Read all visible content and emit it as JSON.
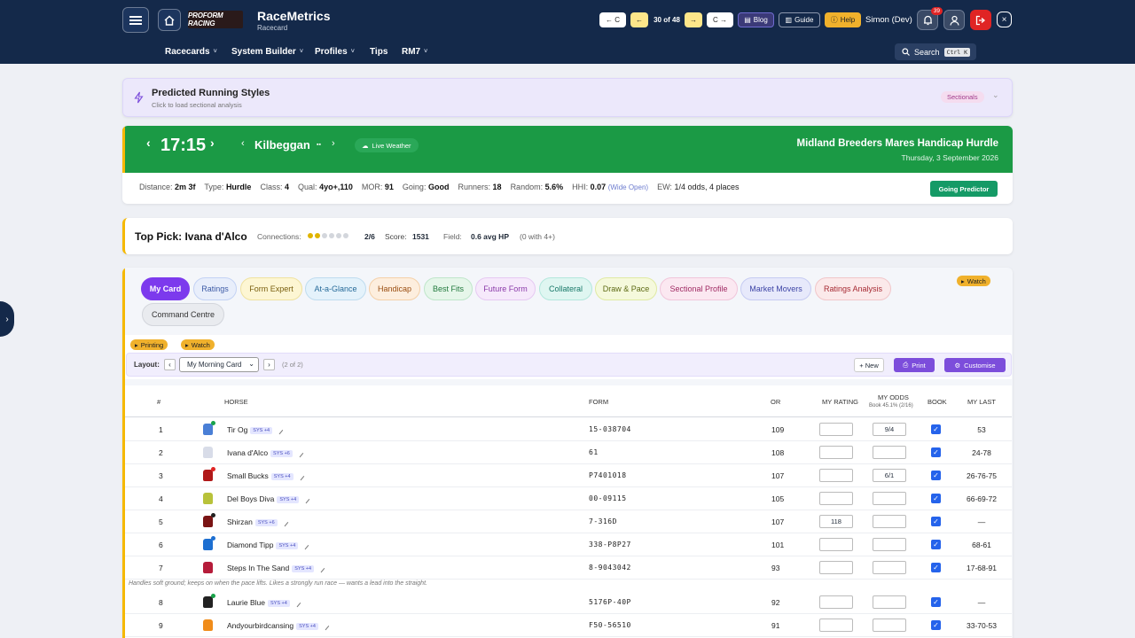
{
  "header": {
    "brand_logo": "PROFORM RACING",
    "app_name": "RaceMetrics",
    "app_sub": "Racecard",
    "prev_c": "← C",
    "nav_count": "30 of 48",
    "next_c": "C →",
    "blog": "Blog",
    "guide": "Guide",
    "help": "Help",
    "user": "Simon (Dev)",
    "notif_count": "39",
    "close": "×"
  },
  "nav": {
    "items": [
      {
        "label": "Racecards",
        "caret": "˅"
      },
      {
        "label": "System Builder",
        "caret": "˅"
      },
      {
        "label": "Profiles",
        "caret": "˅"
      },
      {
        "label": "Tips",
        "caret": ""
      },
      {
        "label": "RM7",
        "caret": "˅"
      }
    ],
    "search_label": "Search",
    "search_kbd": "Ctrl K"
  },
  "predicted": {
    "title": "Predicted Running Styles",
    "subtitle": "Click to load sectional analysis",
    "badge": "Sectionals"
  },
  "race": {
    "time": "17:15",
    "course": "Kilbeggan",
    "weather": "Live Weather",
    "title": "Midland Breeders Mares Handicap Hurdle",
    "date": "Thursday, 3 September 2026",
    "facts": {
      "distance_label": "Distance:",
      "distance": "2m 3f",
      "type_label": "Type:",
      "type": "Hurdle",
      "class_label": "Class:",
      "class": "4",
      "qual_label": "Qual:",
      "qual": "4yo+,110",
      "mor_label": "MOR:",
      "mor": "91",
      "going_label": "Going:",
      "going": "Good",
      "runners_label": "Runners:",
      "runners": "18",
      "random_label": "Random:",
      "random": "5.6%",
      "hhi_label": "HHI:",
      "hhi": "0.07",
      "hhi_note": "(Wide Open)",
      "ew_label": "EW:",
      "ew": "1/4 odds, 4 places"
    },
    "going_predictor": "Going Predictor"
  },
  "top_pick": {
    "title": "Top Pick: Ivana d'Alco",
    "connections_label": "Connections:",
    "connections_value": "2/6",
    "score_label": "Score:",
    "score": "1531",
    "field_label": "Field:",
    "field": "0.6 avg HP",
    "field_note": "(0 with 4+)"
  },
  "tabs": [
    {
      "label": "My Card"
    },
    {
      "label": "Ratings"
    },
    {
      "label": "Form Expert"
    },
    {
      "label": "At-a-Glance"
    },
    {
      "label": "Handicap"
    },
    {
      "label": "Best Fits"
    },
    {
      "label": "Future Form"
    },
    {
      "label": "Collateral"
    },
    {
      "label": "Draw & Pace"
    },
    {
      "label": "Sectional Profile"
    },
    {
      "label": "Market Movers"
    },
    {
      "label": "Ratings Analysis"
    },
    {
      "label": "Command Centre"
    }
  ],
  "watch_top": "Watch",
  "tags": {
    "printing": "Printing",
    "watch": "Watch"
  },
  "layout": {
    "label": "Layout:",
    "prev": "‹",
    "next": "›",
    "selected": "My Morning Card",
    "count": "(2 of 2)",
    "new": "+ New",
    "print": "Print",
    "customise": "Customise"
  },
  "table": {
    "headers": {
      "num": "#",
      "horse": "HORSE",
      "form": "FORM",
      "or": "OR",
      "my_rating": "MY RATING",
      "my_odds": "MY ODDS",
      "book_pct": "Book 45.1% (2/16)",
      "book": "BOOK",
      "my_last": "MY LAST"
    },
    "rows": [
      {
        "num": "1",
        "horse": "Tir Og",
        "sys": "SYS +4",
        "form": "15-038704",
        "or": "109",
        "rating": "",
        "odds": "9/4",
        "last": "53",
        "silk": "#4a7fd6",
        "dot": "#19a34a"
      },
      {
        "num": "2",
        "horse": "Ivana d'Alco",
        "sys": "SYS +6",
        "form": "61",
        "or": "108",
        "rating": "",
        "odds": "",
        "last": "24-78",
        "silk": "#d8dce8",
        "dot": ""
      },
      {
        "num": "3",
        "horse": "Small Bucks",
        "sys": "SYS +4",
        "form": "P7401018",
        "or": "107",
        "rating": "",
        "odds": "6/1",
        "last": "26-76-75",
        "silk": "#b01818",
        "dot": "#e02424"
      },
      {
        "num": "4",
        "horse": "Del Boys Diva",
        "sys": "SYS +4",
        "form": "00-09115",
        "or": "105",
        "rating": "",
        "odds": "",
        "last": "66-69-72",
        "silk": "#b8c23a",
        "dot": ""
      },
      {
        "num": "5",
        "horse": "Shirzan",
        "sys": "SYS +6",
        "form": "7-316D",
        "or": "107",
        "rating": "118",
        "odds": "",
        "last": "—",
        "silk": "#7a1414",
        "dot": "#222"
      },
      {
        "num": "6",
        "horse": "Diamond Tipp",
        "sys": "SYS +4",
        "form": "338-P8P27",
        "or": "101",
        "rating": "",
        "odds": "",
        "last": "68-61",
        "silk": "#1d6fd1",
        "dot": "#1d6fd1"
      },
      {
        "num": "7",
        "horse": "Steps In The Sand",
        "sys": "SYS +4",
        "form": "8-9043042",
        "or": "93",
        "rating": "",
        "odds": "",
        "last": "17-68-91",
        "silk": "#b51c3a",
        "dot": ""
      },
      {
        "num": "8",
        "horse": "Laurie Blue",
        "sys": "SYS +4",
        "form": "5176P-40P",
        "or": "92",
        "rating": "",
        "odds": "",
        "last": "—",
        "silk": "#222",
        "dot": "#19a34a"
      },
      {
        "num": "9",
        "horse": "Andyourbirdcansing",
        "sys": "SYS +4",
        "form": "F50-56510",
        "or": "91",
        "rating": "",
        "odds": "",
        "last": "33-70-53",
        "silk": "#f08c1a",
        "dot": ""
      }
    ],
    "note": "Handles soft ground; keeps on when the pace lifts. Likes a strongly run race — wants a lead into the straight."
  },
  "colors": {
    "header_bg": "#14294a",
    "race_band": "#1b9a45",
    "accent_purple": "#7c4ddb",
    "gold": "#f0b12c"
  },
  "icons": [
    "menu-icon",
    "home-icon",
    "bell-icon",
    "user-icon",
    "logout-icon",
    "lightning-icon",
    "cloud-icon",
    "printer-icon",
    "gear-icon",
    "chevron-down-icon"
  ]
}
